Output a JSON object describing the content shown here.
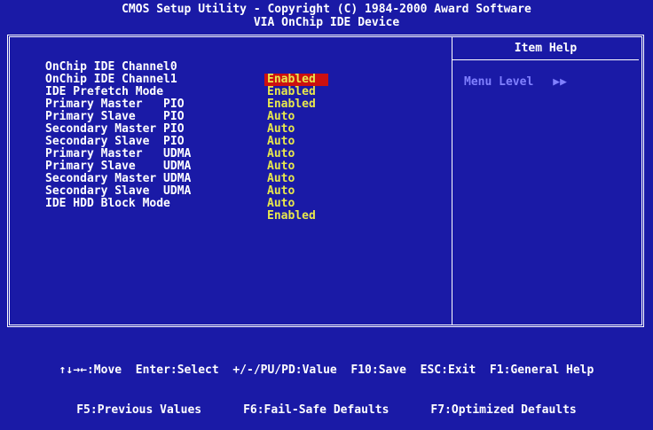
{
  "header": {
    "line1": "CMOS Setup Utility - Copyright (C) 1984-2000 Award Software",
    "line2": "VIA OnChip IDE Device"
  },
  "settings": [
    {
      "label": "OnChip IDE Channel0",
      "value": "Enabled",
      "selected": true
    },
    {
      "label": "OnChip IDE Channel1",
      "value": "Enabled"
    },
    {
      "label": "IDE Prefetch Mode",
      "value": "Enabled"
    },
    {
      "label": "Primary Master   PIO",
      "value": "Auto"
    },
    {
      "label": "Primary Slave    PIO",
      "value": "Auto"
    },
    {
      "label": "Secondary Master PIO",
      "value": "Auto"
    },
    {
      "label": "Secondary Slave  PIO",
      "value": "Auto"
    },
    {
      "label": "Primary Master   UDMA",
      "value": "Auto"
    },
    {
      "label": "Primary Slave    UDMA",
      "value": "Auto"
    },
    {
      "label": "Secondary Master UDMA",
      "value": "Auto"
    },
    {
      "label": "Secondary Slave  UDMA",
      "value": "Auto"
    },
    {
      "label": "IDE HDD Block Mode",
      "value": "Enabled"
    }
  ],
  "help": {
    "title": "Item Help",
    "menu_level_label": "Menu Level",
    "menu_level_arrows": "▶▶"
  },
  "footer": {
    "line1": "↑↓→←:Move  Enter:Select  +/-/PU/PD:Value  F10:Save  ESC:Exit  F1:General Help",
    "line2": "F5:Previous Values      F6:Fail-Safe Defaults      F7:Optimized Defaults"
  },
  "colors": {
    "background": "#1a1aa6",
    "value_text": "#e8e84c",
    "selection_bg": "#cc1010",
    "help_dim_text": "#8080ff"
  }
}
